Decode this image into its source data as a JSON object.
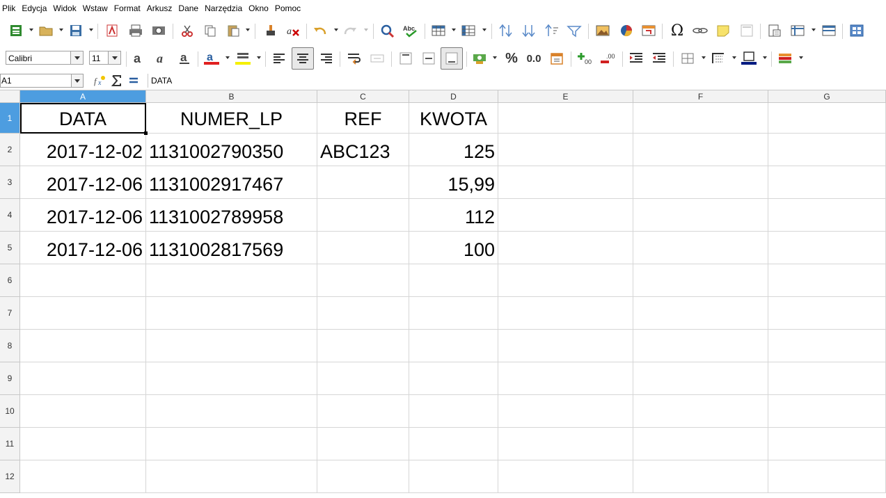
{
  "menu": [
    "Plik",
    "Edycja",
    "Widok",
    "Wstaw",
    "Format",
    "Arkusz",
    "Dane",
    "Narzędzia",
    "Okno",
    "Pomoc"
  ],
  "format_toolbar": {
    "font_name": "Calibri",
    "font_size": "11",
    "percent_label": "%",
    "decimal_label": "0.0"
  },
  "formula_bar": {
    "name_box": "A1",
    "content": "DATA"
  },
  "columns": [
    "A",
    "B",
    "C",
    "D",
    "E",
    "F",
    "G"
  ],
  "rows": [
    "1",
    "2",
    "3",
    "4",
    "5",
    "6",
    "7",
    "8",
    "9",
    "10",
    "11",
    "12"
  ],
  "selected_cell": "A1",
  "sheet": {
    "headers": [
      "DATA",
      "NUMER_LP",
      "REF",
      "KWOTA"
    ],
    "data_rows": [
      [
        "2017-12-02",
        "1131002790350",
        "ABC123",
        "125"
      ],
      [
        "2017-12-06",
        "1131002917467",
        "",
        "15,99"
      ],
      [
        "2017-12-06",
        "1131002789958",
        "",
        "112"
      ],
      [
        "2017-12-06",
        "1131002817569",
        "",
        "100"
      ]
    ]
  }
}
